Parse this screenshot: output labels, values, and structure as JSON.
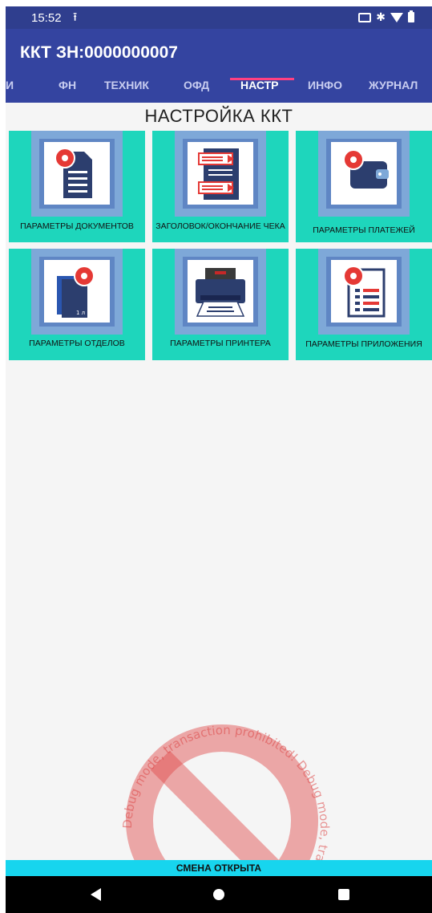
{
  "status_bar": {
    "time": "15:52",
    "upload_icon": "upload-arrow-icon",
    "right_icons": [
      "cast-icon",
      "bluetooth-icon",
      "wifi-icon",
      "battery-icon"
    ]
  },
  "app_bar": {
    "title": "ККТ ЗН:0000000007"
  },
  "tabs": [
    {
      "label": "И",
      "active": false
    },
    {
      "label": "ФН",
      "active": false
    },
    {
      "label": "ТЕХНИК",
      "active": false
    },
    {
      "label": "ОФД",
      "active": false
    },
    {
      "label": "НАСТР",
      "active": true
    },
    {
      "label": "ИНФО",
      "active": false
    },
    {
      "label": "ЖУРНАЛ",
      "active": false
    }
  ],
  "section_title": "НАСТРОЙКА ККТ",
  "tiles": [
    {
      "label": "ПАРАМЕТРЫ ДОКУМЕНТОВ",
      "icon": "document-settings-icon"
    },
    {
      "label": "ЗАГОЛОВОК/ОКОНЧАНИЕ ЧЕКА",
      "icon": "receipt-header-icon"
    },
    {
      "label": "ПАРАМЕТРЫ ПЛАТЕЖЕЙ",
      "icon": "wallet-settings-icon"
    },
    {
      "label": "ПАРАМЕТРЫ ОТДЕЛОВ",
      "icon": "departments-settings-icon"
    },
    {
      "label": "ПАРАМЕТРЫ ПРИНТЕРА",
      "icon": "printer-icon"
    },
    {
      "label": "ПАРАМЕТРЫ ПРИЛОЖЕНИЯ",
      "icon": "app-settings-icon"
    }
  ],
  "watermark_text": "Debug mode, transaction prohibited! Debug mode, transaction prohibited!",
  "shift_status": "СМЕНА ОТКРЫТА",
  "colors": {
    "app_bar": "#3444a0",
    "status_bar": "#2f3e8e",
    "tile_background": "#1ed6bc",
    "tab_indicator": "#ff4081",
    "shift_bar": "#17d5ee",
    "gear": "#e53935"
  }
}
